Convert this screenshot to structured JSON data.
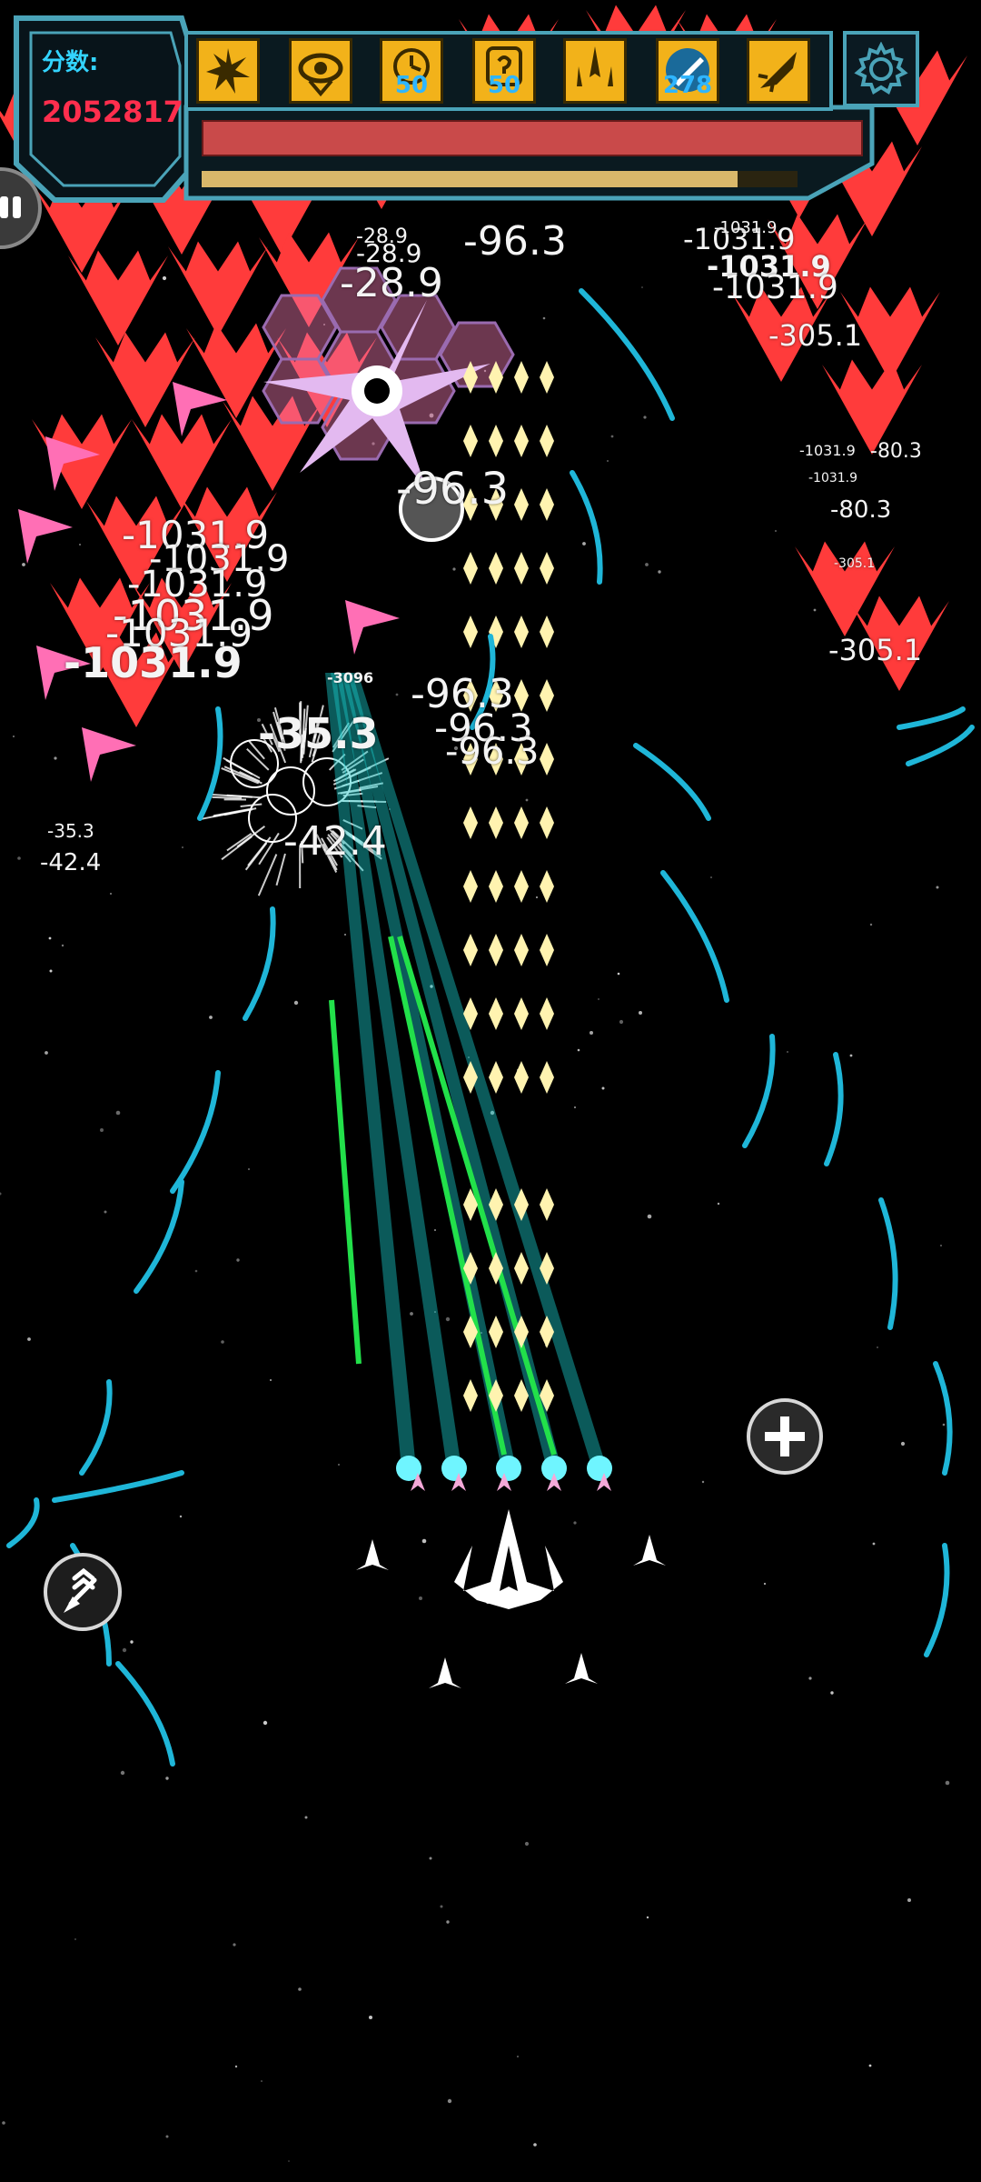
{
  "hud": {
    "score_label": "分数:",
    "score_value": "2052817",
    "skills": [
      {
        "icon": "burst-icon",
        "count": ""
      },
      {
        "icon": "eye-shield-icon",
        "count": ""
      },
      {
        "icon": "radar-clock-icon",
        "count": "50"
      },
      {
        "icon": "mystery-icon",
        "count": "50"
      },
      {
        "icon": "wingmen-icon",
        "count": ""
      },
      {
        "icon": "missile-icon",
        "count": "278"
      },
      {
        "icon": "jet-icon",
        "count": ""
      }
    ],
    "settings_icon": "gear-icon",
    "health_fill": 1.0,
    "energy_fill": 0.9,
    "colors": {
      "frame": "#4aa3b8",
      "skill_bg": "#f2b21a",
      "health": "#c94a4a",
      "energy": "#d9b86a",
      "score": "#ff2e4d",
      "score_label": "#33d4ff"
    }
  },
  "damage_numbers": [
    "-28.9",
    "-28.9",
    "-28.9",
    "-96.3",
    "-1031.9",
    "-1031.9",
    "-1031.9",
    "-1031.9",
    "-305.1",
    "-1031.9",
    "-80.3",
    "-1031.9",
    "-80.3",
    "-305.1",
    "-305.1",
    "-96.3",
    "-1031.9",
    "-1031.9",
    "-1031.9",
    "-1031.9",
    "-1031.9",
    "-1031.9",
    "-3096",
    "-96.3",
    "-96.3",
    "-96.3",
    "-35.3",
    "-42.4",
    "-35.3",
    "-42.4"
  ],
  "controls": {
    "add_icon": "plus-icon",
    "boost_icon": "rocket-boost-icon",
    "pause_icon": "pause-icon"
  },
  "colors": {
    "enemy": "#ff3b3b",
    "enemy_pink": "#ff6fb5",
    "laser": "#19c7c7",
    "green_laser": "#22e04a",
    "bullet": "#fff3b0",
    "streak": "#1fb6d8"
  }
}
